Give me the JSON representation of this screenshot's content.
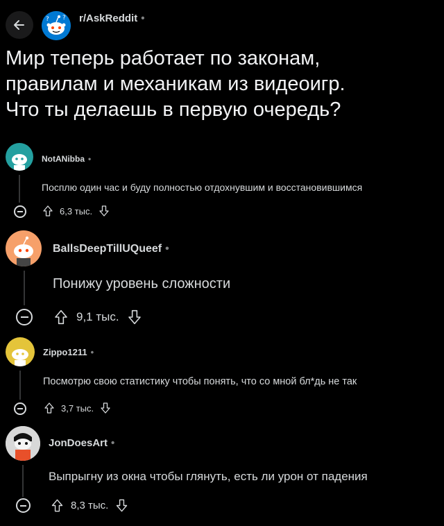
{
  "header": {
    "subreddit": "r/AskReddit",
    "separator": "•"
  },
  "post": {
    "title_lines": [
      "Мир теперь работает по законам,",
      "правилам и механикам из видеоигр.",
      "Что ты делаешь в первую очередь?"
    ]
  },
  "comments": [
    {
      "author": "NotANibba",
      "separator": "•",
      "body": "Посплю один час и буду полностью отдохнувшим и восстановившимся",
      "score": "6,3 тыс.",
      "avatar_color": "#24a0a0"
    },
    {
      "author": "BallsDeepTillUQueef",
      "separator": "•",
      "body": "Понижу уровень сложности",
      "score": "9,1 тыс.",
      "avatar_color": "#f6a06a"
    },
    {
      "author": "Zippo1211",
      "separator": "•",
      "body": "Посмотрю свою статистику чтобы понять, что со мной бл*дь не так",
      "score": "3,7 тыс.",
      "avatar_color": "#e4c43a"
    },
    {
      "author": "JonDoesArt",
      "separator": "•",
      "body": "Выпрыгну из окна чтобы глянуть, есть ли урон от падения",
      "score": "8,3 тыс.",
      "avatar_color": "#d0d0d0"
    }
  ]
}
